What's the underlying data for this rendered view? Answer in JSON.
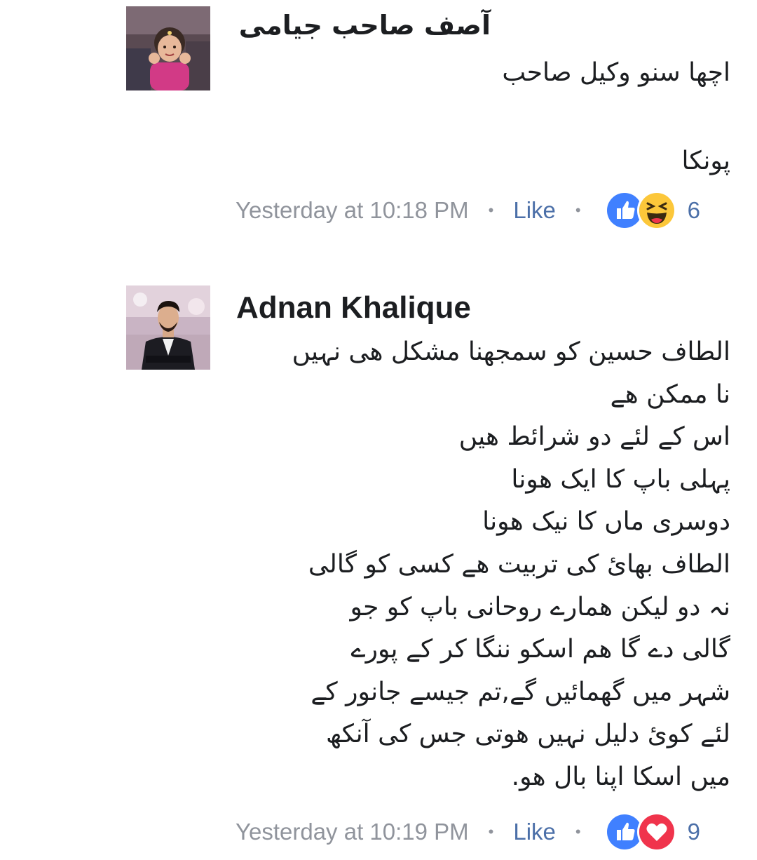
{
  "comments": [
    {
      "author": "آصف صاحب جیامی",
      "lines": [
        "اچھا سنو وکیل صاحب",
        "",
        "پونکا"
      ],
      "time": "Yesterday at 10:18 PM",
      "like_label": "Like",
      "reactions": [
        "like-icon",
        "haha-icon"
      ],
      "reaction_count": "6"
    },
    {
      "author": "Adnan Khalique",
      "lines": [
        "الطاف حسین کو سمجھنا مشکل ھی نہیں",
        "نا ممکن ھے",
        "اس کے لئے دو شرائط ھیں",
        "پہلی باپ کا ایک ھونا",
        "دوسری ماں کا نیک ھونا",
        "الطاف بھائ کی تربیت ھے کسی کو گالی",
        "نہ دو لیکن ھمارے روحانی باپ کو جو",
        "گالی دے گا ھم اسکو ننگا  کر کے پورے",
        "شہر میں گھمائیں گے,تم جیسے جانور کے",
        "لئے کوئ دلیل نہیں ھوتی جس کی آنکھ",
        "میں اسکا اپنا بال ھو."
      ],
      "time": "Yesterday at 10:19 PM",
      "like_label": "Like",
      "reactions": [
        "like-icon",
        "love-icon"
      ],
      "reaction_count": "9"
    }
  ],
  "meta_separator": "•",
  "colors": {
    "timestamp": "#90949c",
    "link": "#4b6fa8",
    "like_blue": "#4080ff",
    "haha_yellow": "#fcc73a",
    "love_red": "#f0344c"
  }
}
